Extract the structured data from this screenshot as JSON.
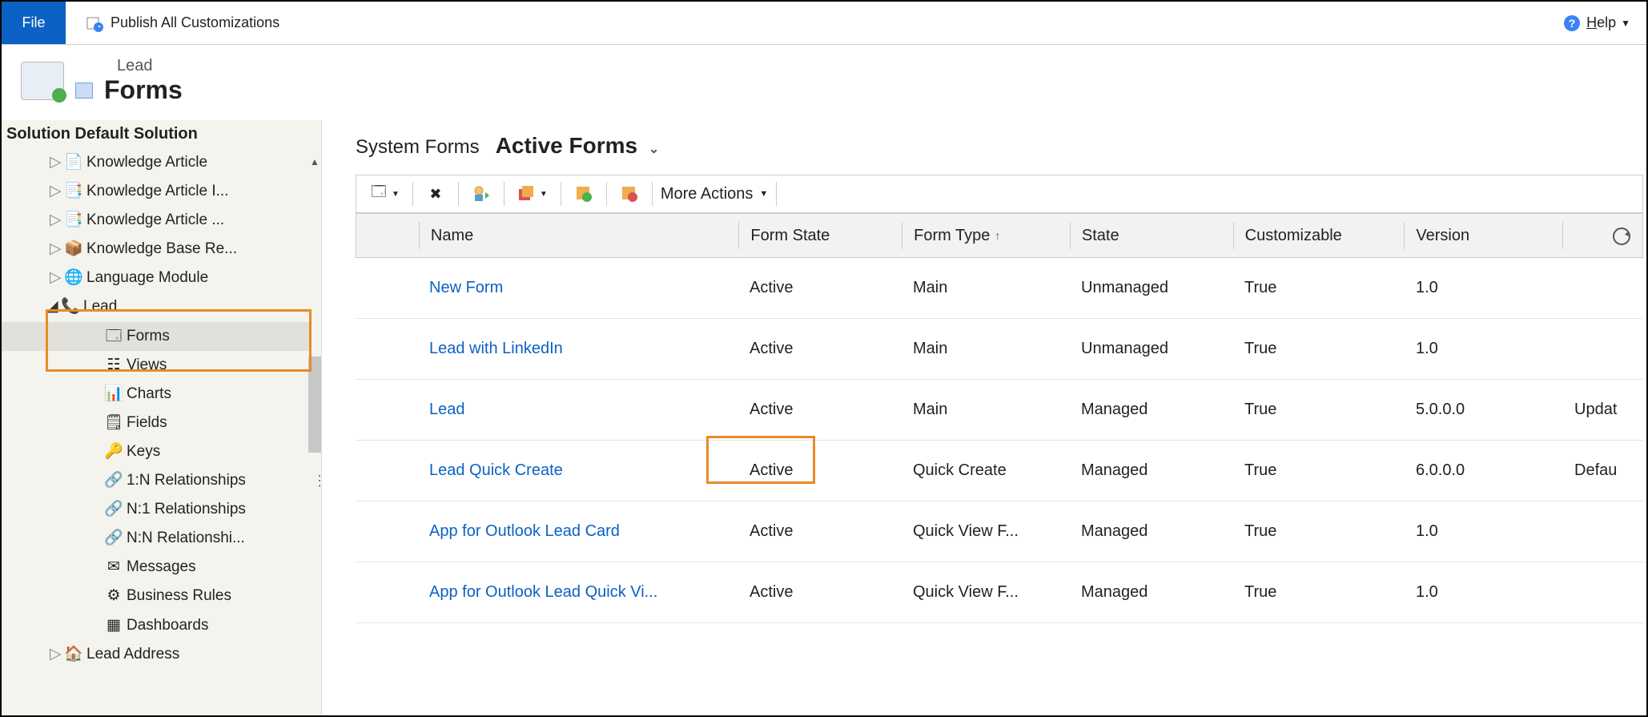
{
  "ribbon": {
    "file": "File",
    "publish": "Publish All Customizations",
    "help": "Help"
  },
  "breadcrumb": {
    "entity": "Lead",
    "page": "Forms"
  },
  "sidebar": {
    "title": "Solution Default Solution",
    "nodes": {
      "knowledge_article": "Knowledge Article",
      "knowledge_article_i": "Knowledge Article I...",
      "knowledge_article_dots": "Knowledge Article ...",
      "knowledge_base_re": "Knowledge Base Re...",
      "language_module": "Language Module",
      "lead": "Lead",
      "lead_address": "Lead Address"
    },
    "children": {
      "forms": "Forms",
      "views": "Views",
      "charts": "Charts",
      "fields": "Fields",
      "keys": "Keys",
      "one_n": "1:N Relationships",
      "n_one": "N:1 Relationships",
      "n_n": "N:N Relationshi...",
      "messages": "Messages",
      "business_rules": "Business Rules",
      "dashboards": "Dashboards"
    }
  },
  "view": {
    "label": "System Forms",
    "selected": "Active Forms"
  },
  "toolbar": {
    "more_actions": "More Actions"
  },
  "columns": {
    "name": "Name",
    "form_state": "Form State",
    "form_type": "Form Type",
    "state": "State",
    "customizable": "Customizable",
    "version": "Version"
  },
  "rows": [
    {
      "name": "New Form",
      "form_state": "Active",
      "form_type": "Main",
      "state": "Unmanaged",
      "customizable": "True",
      "version": "1.0",
      "desc": ""
    },
    {
      "name": "Lead with LinkedIn",
      "form_state": "Active",
      "form_type": "Main",
      "state": "Unmanaged",
      "customizable": "True",
      "version": "1.0",
      "desc": ""
    },
    {
      "name": "Lead",
      "form_state": "Active",
      "form_type": "Main",
      "state": "Managed",
      "customizable": "True",
      "version": "5.0.0.0",
      "desc": "Updat"
    },
    {
      "name": "Lead Quick Create",
      "form_state": "Active",
      "form_type": "Quick Create",
      "state": "Managed",
      "customizable": "True",
      "version": "6.0.0.0",
      "desc": "Defau"
    },
    {
      "name": "App for Outlook Lead Card",
      "form_state": "Active",
      "form_type": "Quick View F...",
      "state": "Managed",
      "customizable": "True",
      "version": "1.0",
      "desc": ""
    },
    {
      "name": "App for Outlook Lead Quick Vi...",
      "form_state": "Active",
      "form_type": "Quick View F...",
      "state": "Managed",
      "customizable": "True",
      "version": "1.0",
      "desc": ""
    }
  ]
}
